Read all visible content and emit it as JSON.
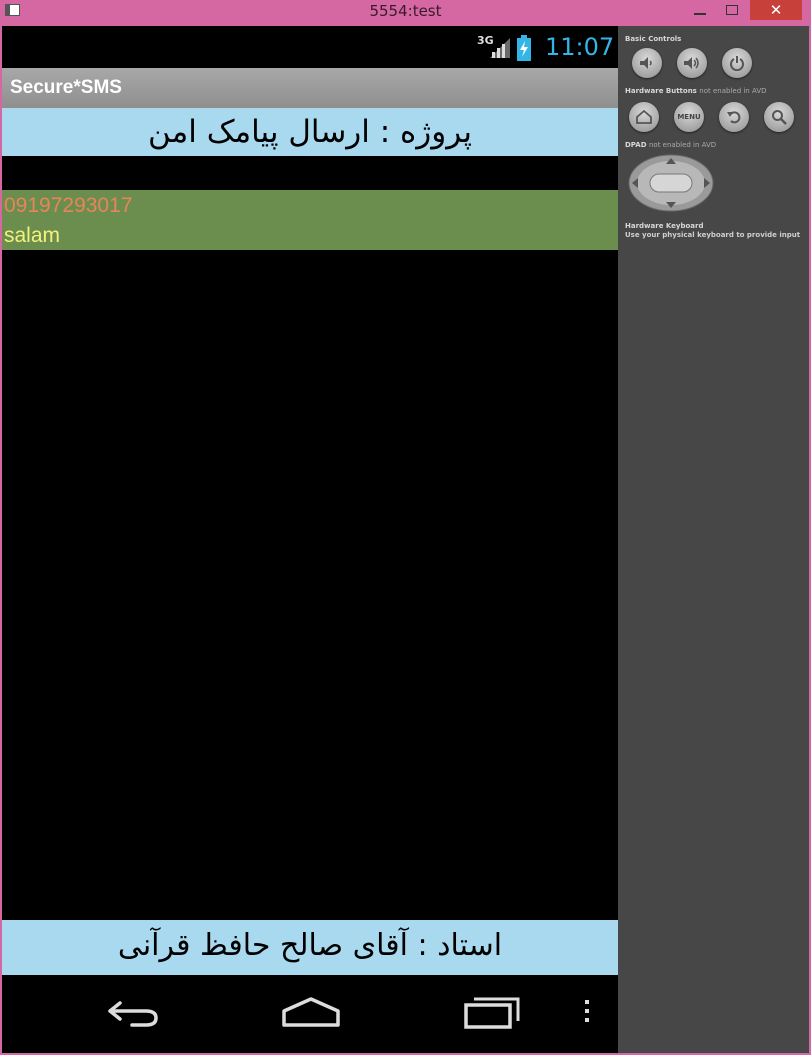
{
  "window": {
    "title": "5554:test",
    "close_label": "✕"
  },
  "status_bar": {
    "network": "3G",
    "time": "11:07"
  },
  "action_bar": {
    "app_name": "Secure*SMS"
  },
  "header_banner": {
    "text": "پروژه : ارسال پیامک امن"
  },
  "messages": [
    {
      "number": "09197293017",
      "body": "salam"
    }
  ],
  "footer_banner": {
    "text": "استاد : آقای صالح حافظ قرآنی"
  },
  "navigation": {
    "buttons": [
      "back-icon",
      "home-icon",
      "recent-apps-icon",
      "overflow-menu-icon"
    ]
  },
  "controls_panel": {
    "basic_controls_label": "Basic Controls",
    "hardware_buttons_label": "Hardware Buttons",
    "hardware_buttons_note": "not enabled in AVD",
    "dpad_label": "DPAD",
    "dpad_note": "not enabled in AVD",
    "keyboard_label": "Hardware Keyboard",
    "keyboard_note": "Use your physical keyboard to provide input",
    "menu_label": "MENU"
  },
  "colors": {
    "window_frame": "#d567a3",
    "banner": "#a9d9ef",
    "message_bg": "#6b8e4e",
    "number_text": "#e8845a",
    "body_text": "#f4f27a",
    "clock": "#33b5e5"
  }
}
